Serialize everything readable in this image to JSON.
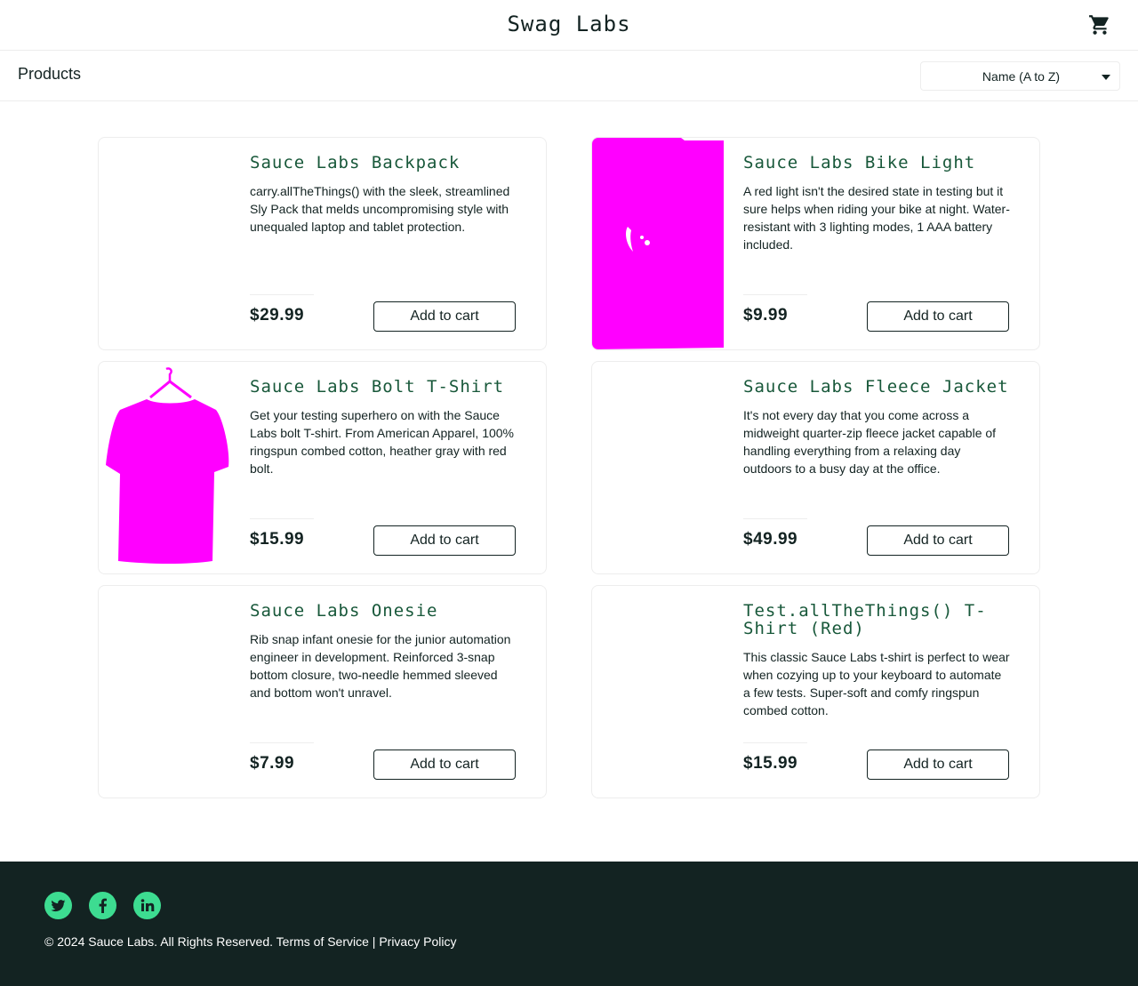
{
  "header": {
    "logo": "Swag Labs",
    "cart_icon": "shopping-cart-icon"
  },
  "secondary": {
    "title": "Products",
    "sort": {
      "selected": "Name (A to Z)",
      "icon": "caret-down-icon"
    }
  },
  "products": [
    {
      "name": "Sauce Labs Backpack",
      "description": "carry.allTheThings() with the sleek, streamlined Sly Pack that melds uncompromising style with unequaled laptop and tablet protection.",
      "price": "$29.99",
      "button": "Add to cart"
    },
    {
      "name": "Sauce Labs Bike Light",
      "description": "A red light isn't the desired state in testing but it sure helps when riding your bike at night. Water-resistant with 3 lighting modes, 1 AAA battery included.",
      "price": "$9.99",
      "button": "Add to cart"
    },
    {
      "name": "Sauce Labs Bolt T-Shirt",
      "description": "Get your testing superhero on with the Sauce Labs bolt T-shirt. From American Apparel, 100% ringspun combed cotton, heather gray with red bolt.",
      "price": "$15.99",
      "button": "Add to cart"
    },
    {
      "name": "Sauce Labs Fleece Jacket",
      "description": "It's not every day that you come across a midweight quarter-zip fleece jacket capable of handling everything from a relaxing day outdoors to a busy day at the office.",
      "price": "$49.99",
      "button": "Add to cart"
    },
    {
      "name": "Sauce Labs Onesie",
      "description": "Rib snap infant onesie for the junior automation engineer in development. Reinforced 3-snap bottom closure, two-needle hemmed sleeved and bottom won't unravel.",
      "price": "$7.99",
      "button": "Add to cart"
    },
    {
      "name": "Test.allTheThings() T-Shirt (Red)",
      "description": "This classic Sauce Labs t-shirt is perfect to wear when cozying up to your keyboard to automate a few tests. Super-soft and comfy ringspun combed cotton.",
      "price": "$15.99",
      "button": "Add to cart"
    }
  ],
  "footer": {
    "social": [
      "twitter-icon",
      "facebook-icon",
      "linkedin-icon"
    ],
    "copyright": "© 2024 Sauce Labs. All Rights Reserved. Terms of Service | Privacy Policy"
  },
  "colors": {
    "accent_green": "#3ddc91",
    "product_name": "#18583a",
    "footer_bg": "#132322",
    "image_placeholder": "#ff00ff"
  }
}
